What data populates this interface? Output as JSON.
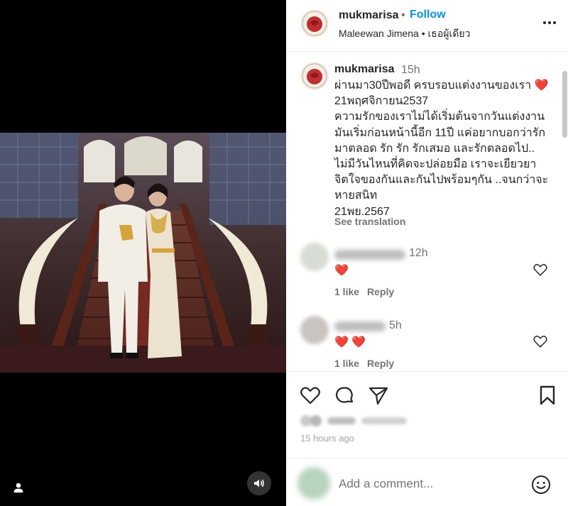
{
  "post": {
    "username": "mukmarisa",
    "separator": "•",
    "follow_label": "Follow",
    "subtitle": "Maleewan Jimena • เธอผู้เดียว"
  },
  "caption": {
    "username": "mukmarisa",
    "time": "15h",
    "lines": [
      "ผ่านมา30ปีพอดี ครบรอบแต่งงานของเรา ❤️",
      "21พฤศจิกายน2537",
      "ความรักของเราไม่ได้เริ่มต้นจากวันแต่งงาน",
      "มันเริ่มก่อนหน้านี้อีก 11ปี แค่อยากบอกว่ารัก",
      "มาตลอด รัก รัก รักเสมอ และรักตลอดไป..",
      "ไม่มีวันไหนที่คิดจะปล่อยมือ เราจะเยียวยา",
      "จิตใจของกันและกันไปพร้อมๆกัน ..จนกว่าจะ",
      "หายสนิท",
      "21พย.2567"
    ],
    "see_translation": "See translation"
  },
  "comments": [
    {
      "time": "12h",
      "hearts": "❤️",
      "likes": "1 like",
      "reply": "Reply"
    },
    {
      "time": "5h",
      "hearts": "❤️ ❤️",
      "likes": "1 like",
      "reply": "Reply"
    }
  ],
  "actions": {
    "icons": [
      "heart-outline-icon",
      "comment-icon",
      "share-icon",
      "bookmark-icon"
    ]
  },
  "post_time": "15 hours ago",
  "comment_bar": {
    "placeholder": "Add a comment...",
    "emoji_icon": "smiley-icon"
  },
  "colors": {
    "accent": "#0095f6",
    "heart": "#ed1c24",
    "muted": "#737373"
  }
}
